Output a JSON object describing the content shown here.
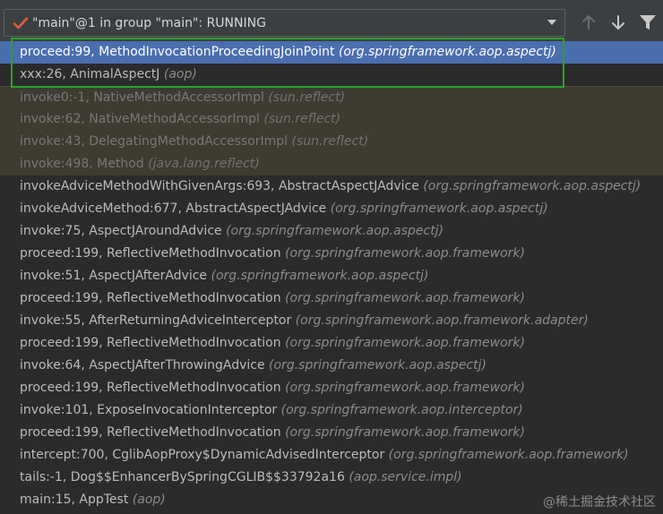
{
  "toolbar": {
    "thread_label": "\"main\"@1 in group \"main\": RUNNING",
    "icons": [
      "check-icon",
      "dropdown-arrow-icon",
      "arrow-up-icon",
      "arrow-down-icon",
      "filter-icon"
    ]
  },
  "colors": {
    "selected_row": "#4b6eaf",
    "library_row": "#3e3b30",
    "highlight_border": "#27a52b",
    "check_mark": "#e05c3b"
  },
  "frames": [
    {
      "method": "proceed:99, MethodInvocationProceedingJoinPoint",
      "pkg": "(org.springframework.aop.aspectj)",
      "state": "selected"
    },
    {
      "method": "xxx:26, AnimalAspectJ",
      "pkg": "(aop)",
      "state": "normal"
    },
    {
      "method": "invoke0:-1, NativeMethodAccessorImpl",
      "pkg": "(sun.reflect)",
      "state": "library"
    },
    {
      "method": "invoke:62, NativeMethodAccessorImpl",
      "pkg": "(sun.reflect)",
      "state": "library"
    },
    {
      "method": "invoke:43, DelegatingMethodAccessorImpl",
      "pkg": "(sun.reflect)",
      "state": "library"
    },
    {
      "method": "invoke:498, Method",
      "pkg": "(java.lang.reflect)",
      "state": "library"
    },
    {
      "method": "invokeAdviceMethodWithGivenArgs:693, AbstractAspectJAdvice",
      "pkg": "(org.springframework.aop.aspectj)",
      "state": "normal"
    },
    {
      "method": "invokeAdviceMethod:677, AbstractAspectJAdvice",
      "pkg": "(org.springframework.aop.aspectj)",
      "state": "normal"
    },
    {
      "method": "invoke:75, AspectJAroundAdvice",
      "pkg": "(org.springframework.aop.aspectj)",
      "state": "normal"
    },
    {
      "method": "proceed:199, ReflectiveMethodInvocation",
      "pkg": "(org.springframework.aop.framework)",
      "state": "normal"
    },
    {
      "method": "invoke:51, AspectJAfterAdvice",
      "pkg": "(org.springframework.aop.aspectj)",
      "state": "normal"
    },
    {
      "method": "proceed:199, ReflectiveMethodInvocation",
      "pkg": "(org.springframework.aop.framework)",
      "state": "normal"
    },
    {
      "method": "invoke:55, AfterReturningAdviceInterceptor",
      "pkg": "(org.springframework.aop.framework.adapter)",
      "state": "normal"
    },
    {
      "method": "proceed:199, ReflectiveMethodInvocation",
      "pkg": "(org.springframework.aop.framework)",
      "state": "normal"
    },
    {
      "method": "invoke:64, AspectJAfterThrowingAdvice",
      "pkg": "(org.springframework.aop.aspectj)",
      "state": "normal"
    },
    {
      "method": "proceed:199, ReflectiveMethodInvocation",
      "pkg": "(org.springframework.aop.framework)",
      "state": "normal"
    },
    {
      "method": "invoke:101, ExposeInvocationInterceptor",
      "pkg": "(org.springframework.aop.interceptor)",
      "state": "normal"
    },
    {
      "method": "proceed:199, ReflectiveMethodInvocation",
      "pkg": "(org.springframework.aop.framework)",
      "state": "normal"
    },
    {
      "method": "intercept:700, CglibAopProxy$DynamicAdvisedInterceptor",
      "pkg": "(org.springframework.aop.framework)",
      "state": "normal"
    },
    {
      "method": "tails:-1, Dog$$EnhancerBySpringCGLIB$$33792a16",
      "pkg": "(aop.service.impl)",
      "state": "normal"
    },
    {
      "method": "main:15, AppTest",
      "pkg": "(aop)",
      "state": "normal"
    }
  ],
  "watermark": "@稀土掘金技术社区"
}
